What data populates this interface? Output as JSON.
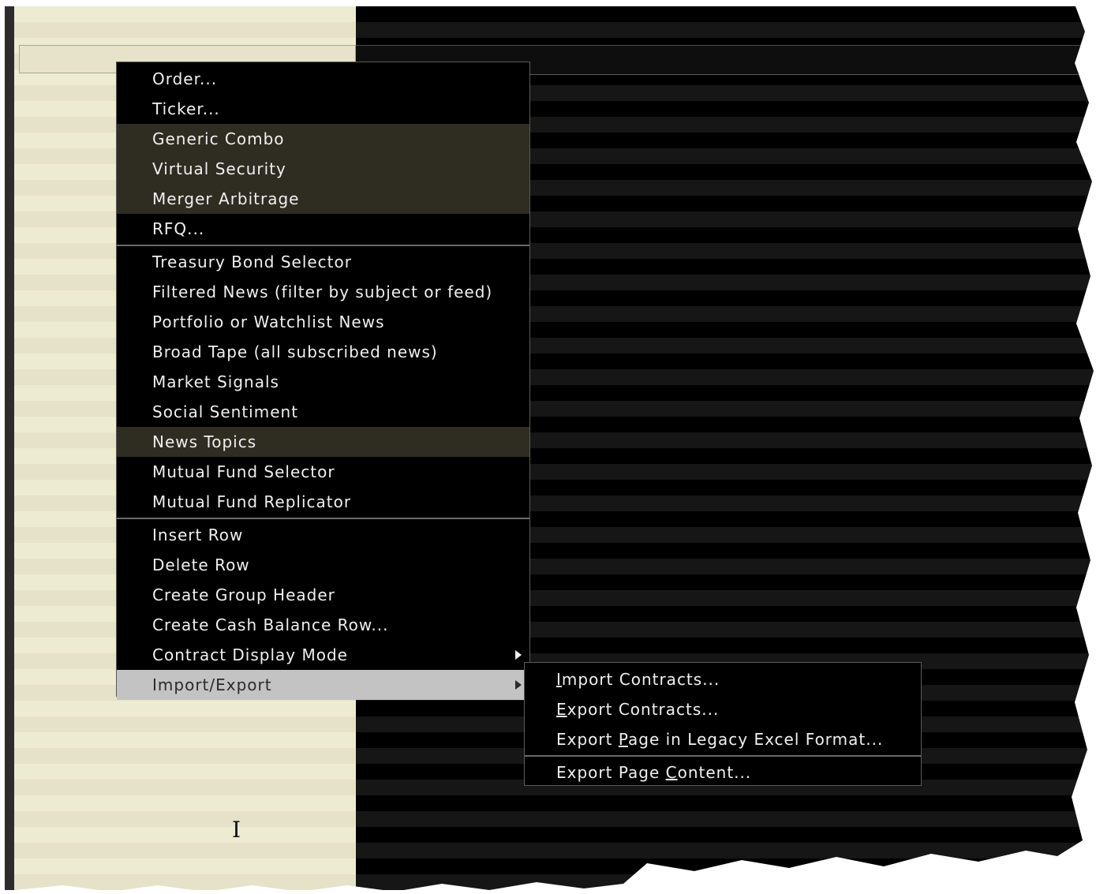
{
  "context_menu": {
    "items": [
      {
        "label": "Order..."
      },
      {
        "label": "Ticker..."
      },
      {
        "label": "Generic Combo"
      },
      {
        "label": "Virtual Security"
      },
      {
        "label": "Merger Arbitrage"
      },
      {
        "label": "RFQ..."
      },
      {
        "label": "Treasury Bond Selector"
      },
      {
        "label": "Filtered News (filter by subject or feed)"
      },
      {
        "label": "Portfolio or Watchlist News"
      },
      {
        "label": "Broad Tape (all subscribed news)"
      },
      {
        "label": "Market Signals"
      },
      {
        "label": "Social Sentiment"
      },
      {
        "label": "News Topics"
      },
      {
        "label": "Mutual Fund Selector"
      },
      {
        "label": "Mutual Fund Replicator"
      },
      {
        "label": "Insert Row"
      },
      {
        "label": "Delete Row"
      },
      {
        "label": "Create Group Header"
      },
      {
        "label": "Create Cash Balance Row..."
      },
      {
        "label": "Contract Display Mode"
      },
      {
        "label": "Import/Export"
      }
    ]
  },
  "submenu": {
    "items": [
      {
        "mnemonic": "I",
        "rest": "mport Contracts..."
      },
      {
        "mnemonic": "E",
        "rest": "xport Contracts..."
      },
      {
        "before": "Export ",
        "mnemonic": "P",
        "rest": "age in Legacy Excel Format..."
      },
      {
        "before": "Export Page ",
        "mnemonic": "C",
        "rest": "ontent..."
      }
    ]
  },
  "icons": {
    "cursor": "text-cursor-icon",
    "submenu_arrow": "triangle-right-icon"
  },
  "colors": {
    "left_panel": "#eeebd3",
    "right_panel": "#000000",
    "menu_bg": "#000000",
    "menu_highlight": "#2f2d22",
    "menu_selected": "#c3c3c3"
  }
}
